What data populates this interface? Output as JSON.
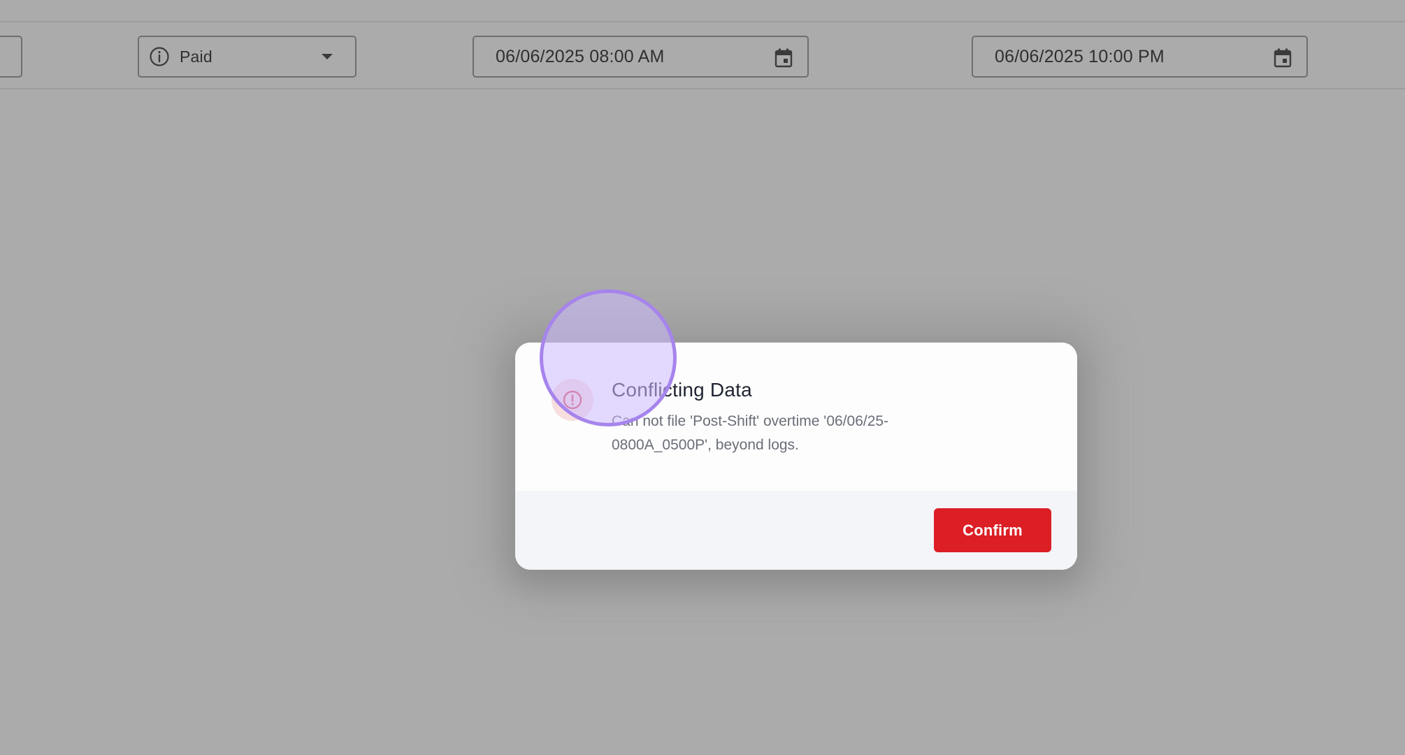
{
  "filter_bar": {
    "pay_type": {
      "value": "Paid",
      "icon": "info-icon"
    },
    "start_datetime": {
      "value": "06/06/2025 08:00 AM",
      "icon": "calendar-icon"
    },
    "end_datetime": {
      "value": "06/06/2025 10:00 PM",
      "icon": "calendar-icon"
    }
  },
  "dialog": {
    "icon": "alert-circle-icon",
    "title": "Conflicting Data",
    "message": "Can not file 'Post-Shift' overtime '06/06/25-0800A_0500P', beyond logs.",
    "confirm_label": "Confirm"
  },
  "colors": {
    "overlay": "#ababab",
    "confirm_button": "#db1f25",
    "alert_badge_bg": "#f8dede",
    "alert_icon": "#d54b5a",
    "click_highlight": "#a684ec"
  }
}
